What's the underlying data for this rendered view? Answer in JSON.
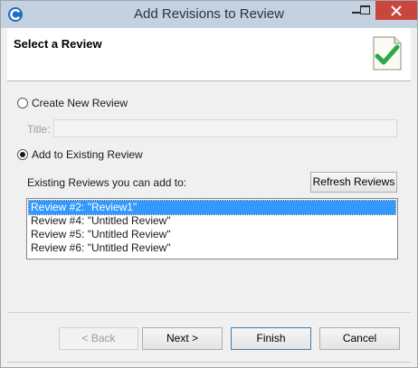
{
  "window": {
    "title": "Add Revisions to Review",
    "icons": {
      "app": "c-logo-icon",
      "minimize": "minimize-icon",
      "maximize": "maximize-icon",
      "close": "close-icon"
    }
  },
  "header": {
    "title": "Select a Review",
    "icon": "checklist-icon"
  },
  "form": {
    "create_new_label": "Create New Review",
    "title_label": "Title:",
    "title_value": "",
    "add_existing_label": "Add to Existing Review",
    "existing_label": "Existing Reviews you can add to:",
    "refresh_label": "Refresh Reviews",
    "selected_option": "existing",
    "reviews": [
      "Review #2: \"Review1\"",
      "Review #4: \"Untitled Review\"",
      "Review #5: \"Untitled Review\"",
      "Review #6: \"Untitled Review\""
    ],
    "selected_review_index": 0
  },
  "buttons": {
    "back": "< Back",
    "next": "Next >",
    "finish": "Finish",
    "cancel": "Cancel"
  },
  "colors": {
    "titlebar": "#c3d1e0",
    "close": "#c9463d",
    "selection": "#3399ff",
    "check": "#2aa84a"
  }
}
